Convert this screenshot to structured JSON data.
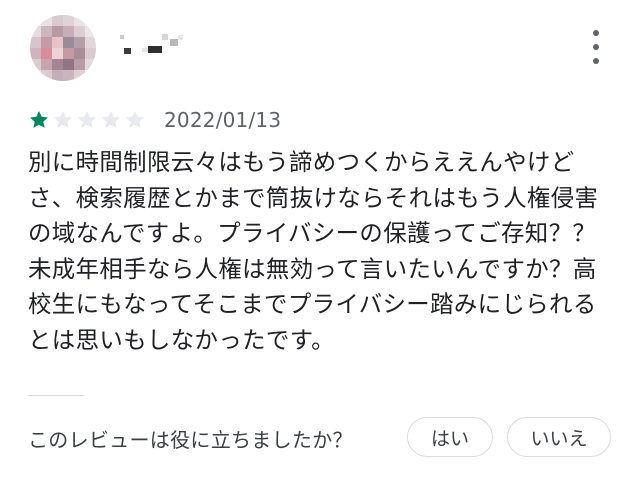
{
  "reviewer": {
    "name": ""
  },
  "review": {
    "rating": 1,
    "max_rating": 5,
    "star_colors": {
      "filled": "#01875f",
      "empty": "#e8eaed"
    },
    "date": "2022/01/13",
    "text": "別に時間制限云々はもう諦めつくからええんやけどさ、検索履歴とかまで筒抜けならそれはもう人権侵害の域なんですよ。プライバシーの保護ってご存知？？未成年相手なら人権は無効って言いたいんですか？高校生にもなってそこまでプライバシー踏みにじられるとは思いもしなかったです。"
  },
  "helpful": {
    "question": "このレビューは役に立ちましたか？",
    "yes_label": "はい",
    "no_label": "いいえ"
  },
  "icons": {
    "more": "more-vert-icon",
    "star": "star-icon"
  }
}
